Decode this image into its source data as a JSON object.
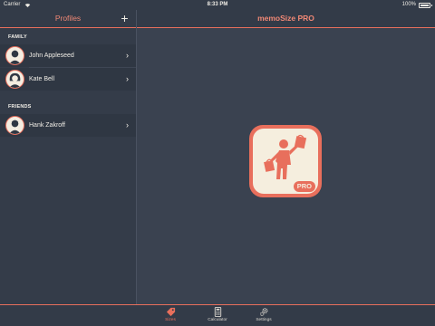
{
  "status_bar": {
    "carrier": "Carrier",
    "time": "8:33 PM",
    "battery": "100%"
  },
  "sidebar": {
    "title": "Profiles",
    "add_label": "+",
    "sections": [
      {
        "header": "FAMILY",
        "items": [
          {
            "name": "John Appleseed"
          },
          {
            "name": "Kate Bell"
          }
        ]
      },
      {
        "header": "FRIENDS",
        "items": [
          {
            "name": "Hank Zakroff"
          }
        ]
      }
    ]
  },
  "detail": {
    "title": "memoSize PRO",
    "icon_badge": "PRO"
  },
  "tab_bar": {
    "tabs": [
      {
        "label": "Sizes",
        "icon": "tag-icon",
        "active": true
      },
      {
        "label": "Calculator",
        "icon": "calculator-icon",
        "active": false
      },
      {
        "label": "Settings",
        "icon": "gear-icon",
        "active": false
      }
    ]
  },
  "colors": {
    "accent": "#e86f5c",
    "background": "#3a4250",
    "bar": "#333b48",
    "cream": "#f5eede"
  }
}
